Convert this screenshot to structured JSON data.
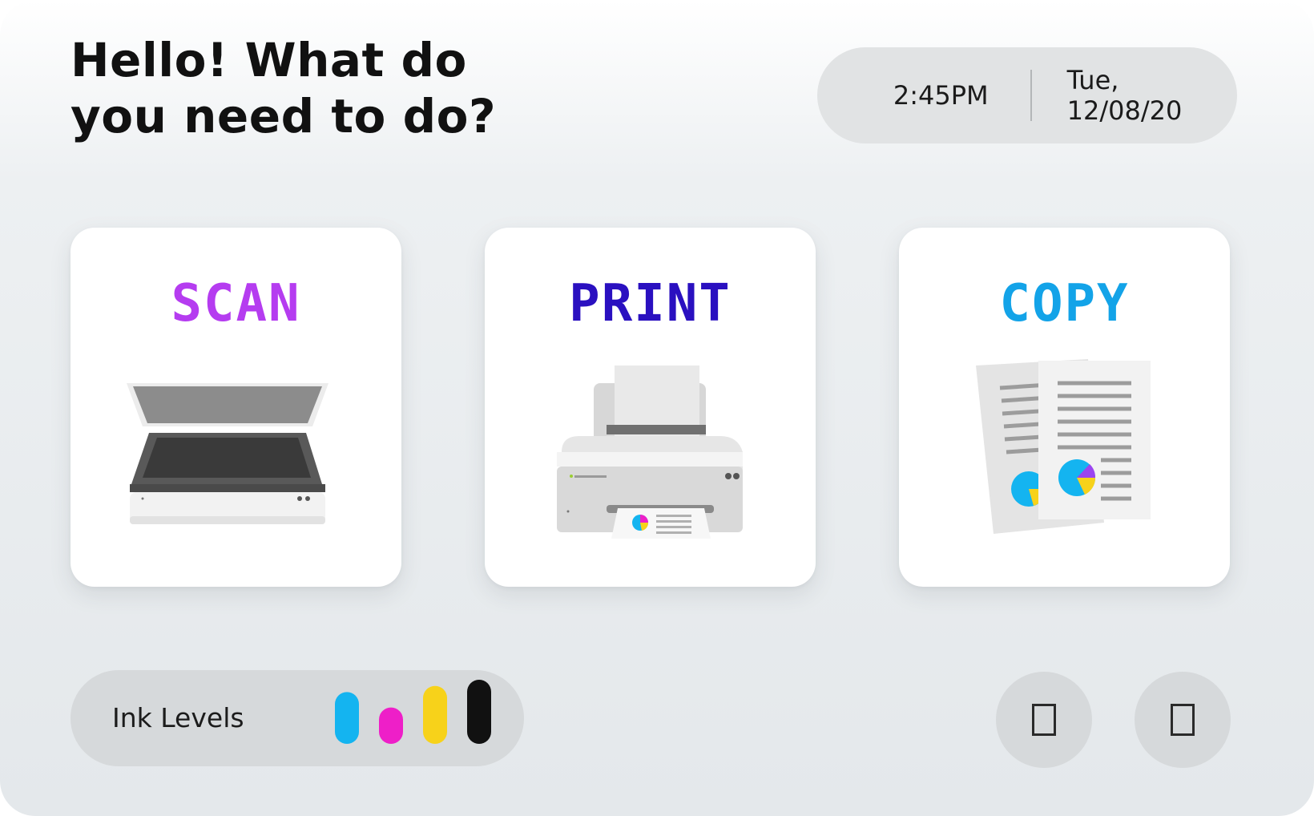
{
  "header": {
    "greeting": "Hello! What do\nyou need to do?",
    "time": "2:45PM",
    "date": "Tue, 12/08/20"
  },
  "actions": [
    {
      "label": "SCAN",
      "color": "#b53cf0",
      "icon": "scanner-icon"
    },
    {
      "label": "PRINT",
      "color": "#2a10c0",
      "icon": "printer-icon"
    },
    {
      "label": "COPY",
      "color": "#13a3e8",
      "icon": "documents-copy-icon"
    }
  ],
  "ink": {
    "label": "Ink Levels",
    "levels": [
      {
        "name": "cyan",
        "color": "#14b4f0",
        "level": 0.45
      },
      {
        "name": "magenta",
        "color": "#ee1fc8",
        "level": 0.2
      },
      {
        "name": "yellow",
        "color": "#f7d21a",
        "level": 0.55
      },
      {
        "name": "black",
        "color": "#111111",
        "level": 0.65
      }
    ]
  },
  "footer_buttons": [
    {
      "icon": "square-outline-icon"
    },
    {
      "icon": "square-outline-icon"
    }
  ]
}
